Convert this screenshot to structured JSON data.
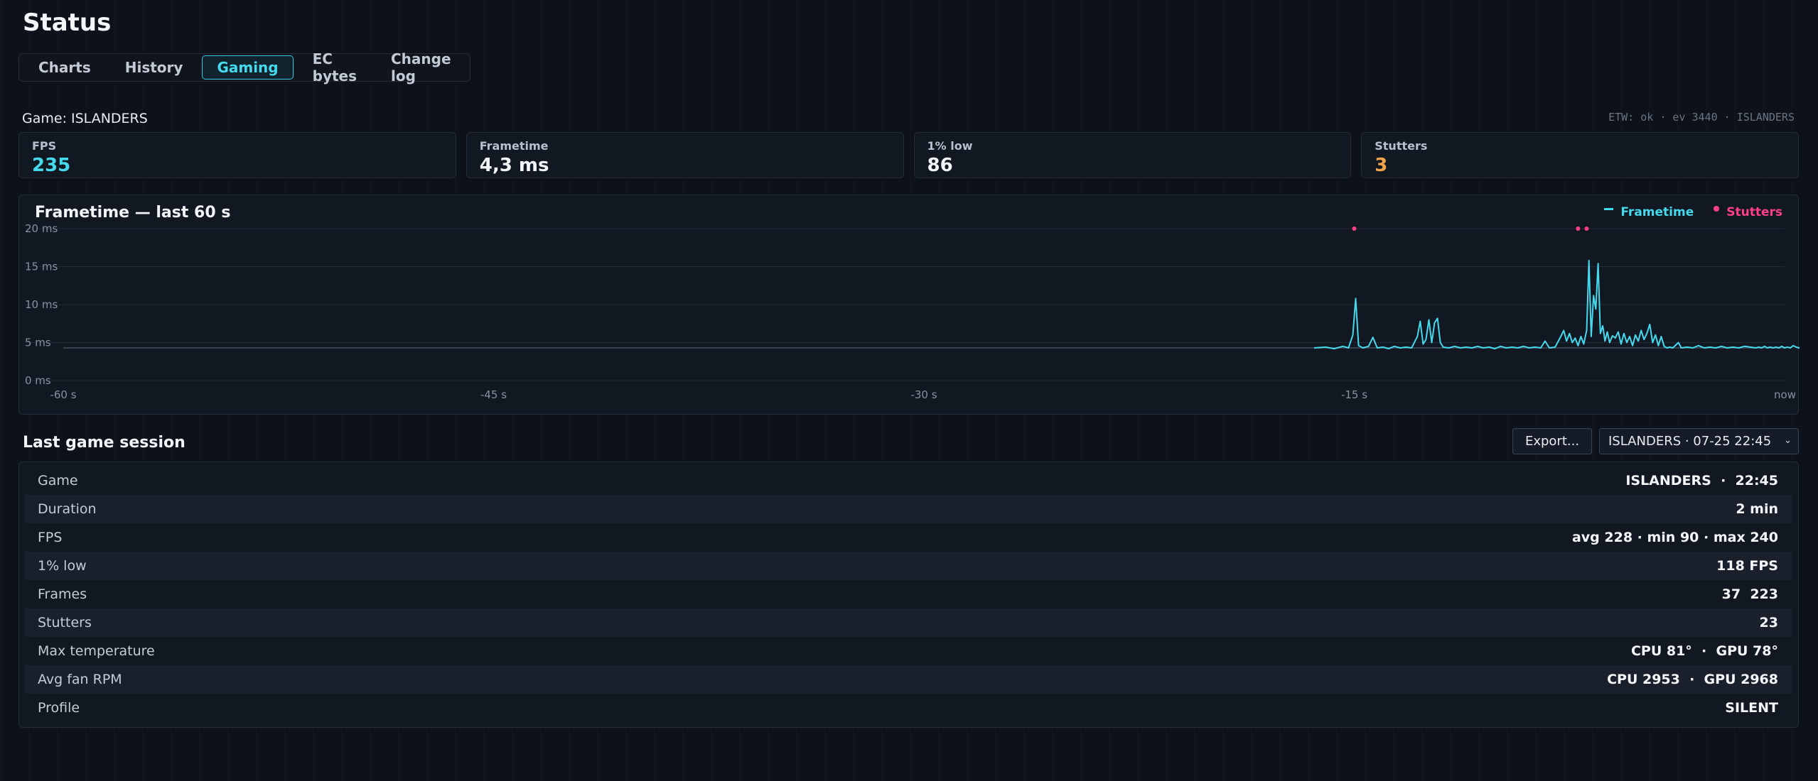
{
  "page": {
    "title": "Status"
  },
  "tabs": [
    {
      "label": "Charts",
      "active": false
    },
    {
      "label": "History",
      "active": false
    },
    {
      "label": "Gaming",
      "active": true
    },
    {
      "label": "EC bytes",
      "active": false
    },
    {
      "label": "Change log",
      "active": false
    }
  ],
  "game_label": "Game: ISLANDERS",
  "etw_status": "ETW: ok · ev 3440 · ISLANDERS",
  "stats": [
    {
      "label": "FPS",
      "value": "235",
      "color": "#45d9ee"
    },
    {
      "label": "Frametime",
      "value": "4,3 ms",
      "color": "#f2f4f8"
    },
    {
      "label": "1% low",
      "value": "86",
      "color": "#f2f4f8"
    },
    {
      "label": "Stutters",
      "value": "3",
      "color": "#f0a34a"
    }
  ],
  "chart": {
    "title": "Frametime — last 60 s",
    "legend": {
      "frametime": "Frametime",
      "stutters": "Stutters"
    },
    "colors": {
      "frametime": "#45d9ee",
      "stutters": "#ff3f85"
    }
  },
  "chart_data": {
    "type": "line",
    "title": "Frametime — last 60 s",
    "xlabel": "",
    "ylabel": "",
    "xlim": [
      -60,
      0
    ],
    "ylim": [
      0,
      20
    ],
    "x_ticks": [
      {
        "value": -60,
        "label": "-60 s"
      },
      {
        "value": -45,
        "label": "-45 s"
      },
      {
        "value": -30,
        "label": "-30 s"
      },
      {
        "value": -15,
        "label": "-15 s"
      },
      {
        "value": 0,
        "label": "now"
      }
    ],
    "y_ticks": [
      {
        "value": 0,
        "label": "0 ms"
      },
      {
        "value": 5,
        "label": "5 ms"
      },
      {
        "value": 10,
        "label": "10 ms"
      },
      {
        "value": 15,
        "label": "15 ms"
      },
      {
        "value": 20,
        "label": "20 ms"
      }
    ],
    "reference_line": 4.3,
    "grid": true,
    "legend_position": "top-right",
    "series": [
      {
        "name": "Frametime",
        "points": [
          [
            -16.4,
            4.3
          ],
          [
            -16.0,
            4.4
          ],
          [
            -15.7,
            4.2
          ],
          [
            -15.4,
            4.5
          ],
          [
            -15.2,
            4.3
          ],
          [
            -15.05,
            6.0
          ],
          [
            -14.95,
            10.8
          ],
          [
            -14.85,
            4.6
          ],
          [
            -14.7,
            4.3
          ],
          [
            -14.5,
            4.5
          ],
          [
            -14.35,
            5.7
          ],
          [
            -14.2,
            4.3
          ],
          [
            -14.0,
            4.4
          ],
          [
            -13.8,
            4.2
          ],
          [
            -13.6,
            4.5
          ],
          [
            -13.4,
            4.3
          ],
          [
            -13.2,
            4.4
          ],
          [
            -13.0,
            4.3
          ],
          [
            -12.8,
            5.8
          ],
          [
            -12.7,
            7.8
          ],
          [
            -12.6,
            4.8
          ],
          [
            -12.5,
            5.4
          ],
          [
            -12.4,
            8.0
          ],
          [
            -12.3,
            5.0
          ],
          [
            -12.2,
            7.6
          ],
          [
            -12.1,
            8.2
          ],
          [
            -12.0,
            5.0
          ],
          [
            -11.9,
            4.4
          ],
          [
            -11.7,
            4.3
          ],
          [
            -11.5,
            4.5
          ],
          [
            -11.3,
            4.3
          ],
          [
            -11.1,
            4.4
          ],
          [
            -10.9,
            4.3
          ],
          [
            -10.7,
            4.5
          ],
          [
            -10.5,
            4.3
          ],
          [
            -10.3,
            4.4
          ],
          [
            -10.1,
            4.2
          ],
          [
            -9.9,
            4.5
          ],
          [
            -9.7,
            4.3
          ],
          [
            -9.5,
            4.4
          ],
          [
            -9.3,
            4.3
          ],
          [
            -9.1,
            4.5
          ],
          [
            -8.9,
            4.3
          ],
          [
            -8.7,
            4.4
          ],
          [
            -8.5,
            4.3
          ],
          [
            -8.35,
            5.2
          ],
          [
            -8.2,
            4.3
          ],
          [
            -8.0,
            4.4
          ],
          [
            -7.8,
            5.8
          ],
          [
            -7.7,
            6.6
          ],
          [
            -7.6,
            5.2
          ],
          [
            -7.5,
            6.2
          ],
          [
            -7.4,
            5.0
          ],
          [
            -7.3,
            5.6
          ],
          [
            -7.2,
            4.6
          ],
          [
            -7.1,
            5.8
          ],
          [
            -7.0,
            4.8
          ],
          [
            -6.9,
            6.6
          ],
          [
            -6.82,
            15.8
          ],
          [
            -6.74,
            5.8
          ],
          [
            -6.66,
            11.2
          ],
          [
            -6.58,
            9.4
          ],
          [
            -6.5,
            15.4
          ],
          [
            -6.42,
            6.2
          ],
          [
            -6.34,
            7.2
          ],
          [
            -6.26,
            5.2
          ],
          [
            -6.18,
            6.4
          ],
          [
            -6.1,
            5.0
          ],
          [
            -6.0,
            5.9
          ],
          [
            -5.9,
            5.6
          ],
          [
            -5.8,
            6.4
          ],
          [
            -5.7,
            4.8
          ],
          [
            -5.6,
            6.2
          ],
          [
            -5.5,
            5.0
          ],
          [
            -5.4,
            5.8
          ],
          [
            -5.3,
            4.6
          ],
          [
            -5.2,
            6.0
          ],
          [
            -5.1,
            5.2
          ],
          [
            -5.0,
            6.6
          ],
          [
            -4.9,
            5.4
          ],
          [
            -4.8,
            6.2
          ],
          [
            -4.7,
            7.4
          ],
          [
            -4.6,
            5.0
          ],
          [
            -4.5,
            6.0
          ],
          [
            -4.4,
            4.6
          ],
          [
            -4.3,
            5.8
          ],
          [
            -4.2,
            4.5
          ],
          [
            -4.1,
            4.3
          ],
          [
            -4.0,
            4.4
          ],
          [
            -3.9,
            4.3
          ],
          [
            -3.7,
            5.0
          ],
          [
            -3.6,
            4.3
          ],
          [
            -3.4,
            4.4
          ],
          [
            -3.2,
            4.3
          ],
          [
            -3.0,
            4.6
          ],
          [
            -2.8,
            4.3
          ],
          [
            -2.6,
            4.4
          ],
          [
            -2.4,
            4.3
          ],
          [
            -2.2,
            4.5
          ],
          [
            -2.0,
            4.3
          ],
          [
            -1.8,
            4.4
          ],
          [
            -1.6,
            4.3
          ],
          [
            -1.4,
            4.5
          ],
          [
            -1.2,
            4.4
          ],
          [
            -1.0,
            4.3
          ],
          [
            -0.9,
            4.4
          ],
          [
            -0.8,
            4.3
          ],
          [
            -0.7,
            4.5
          ],
          [
            -0.6,
            4.3
          ],
          [
            -0.5,
            4.4
          ],
          [
            -0.4,
            4.3
          ],
          [
            -0.3,
            4.4
          ],
          [
            -0.2,
            4.3
          ],
          [
            -0.1,
            4.5
          ],
          [
            0.0,
            4.3
          ],
          [
            0.1,
            4.4
          ],
          [
            0.2,
            4.3
          ],
          [
            0.3,
            4.6
          ],
          [
            0.4,
            4.4
          ],
          [
            0.5,
            4.3
          ],
          [
            0.6,
            4.4
          ],
          [
            0.7,
            4.3
          ],
          [
            0.8,
            4.5
          ],
          [
            0.9,
            4.3
          ],
          [
            1.0,
            4.4
          ],
          [
            1.1,
            4.3
          ],
          [
            1.2,
            4.5
          ],
          [
            1.3,
            4.4
          ],
          [
            1.4,
            4.3
          ],
          [
            1.5,
            4.4
          ]
        ]
      },
      {
        "name": "Stutters",
        "type": "scatter",
        "points": [
          [
            -15.0,
            20
          ],
          [
            -7.2,
            20
          ],
          [
            -6.9,
            20
          ]
        ]
      }
    ]
  },
  "session": {
    "title": "Last game session",
    "export_label": "Export...",
    "selected": "ISLANDERS · 07-25 22:45",
    "rows": [
      {
        "key": "Game",
        "value": "ISLANDERS  ·  22:45"
      },
      {
        "key": "Duration",
        "value": "2 min"
      },
      {
        "key": "FPS",
        "value": "avg 228 · min 90 · max 240"
      },
      {
        "key": "1% low",
        "value": "118 FPS"
      },
      {
        "key": "Frames",
        "value": "37  223"
      },
      {
        "key": "Stutters",
        "value": "23"
      },
      {
        "key": "Max temperature",
        "value": "CPU 81°  ·  GPU 78°"
      },
      {
        "key": "Avg fan RPM",
        "value": "CPU 2953  ·  GPU 2968"
      },
      {
        "key": "Profile",
        "value": "SILENT"
      }
    ]
  }
}
